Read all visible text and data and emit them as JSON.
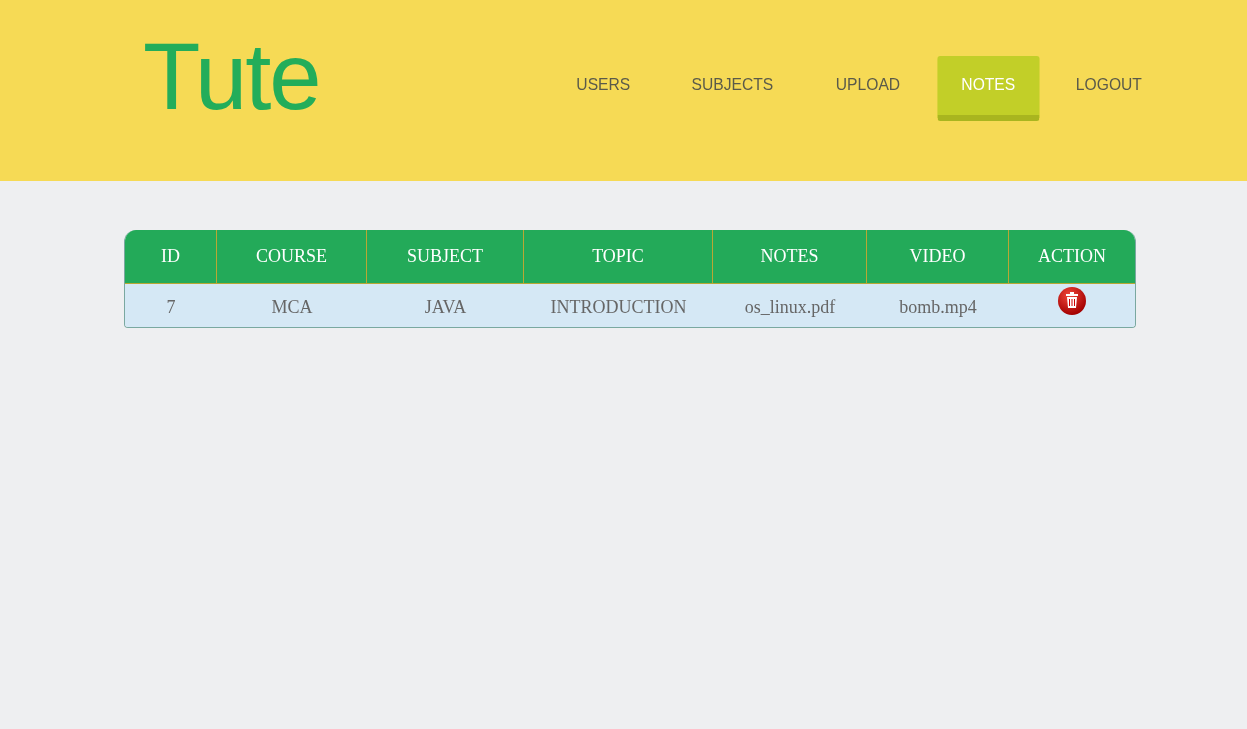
{
  "logo": "Tute",
  "nav": [
    {
      "label": "USERS",
      "selected": false
    },
    {
      "label": "SUBJECTS",
      "selected": false
    },
    {
      "label": "UPLOAD",
      "selected": false
    },
    {
      "label": "NOTES",
      "selected": true
    },
    {
      "label": "LOGOUT",
      "selected": false
    }
  ],
  "table": {
    "columns": [
      "ID",
      "COURSE",
      "SUBJECT",
      "TOPIC",
      "NOTES",
      "VIDEO",
      "ACTION"
    ],
    "rows": [
      {
        "cells": [
          "7",
          "MCA",
          "JAVA",
          "INTRODUCTION",
          "os_linux.pdf",
          "bomb.mp4"
        ],
        "action": {
          "kind": "delete"
        }
      }
    ]
  }
}
